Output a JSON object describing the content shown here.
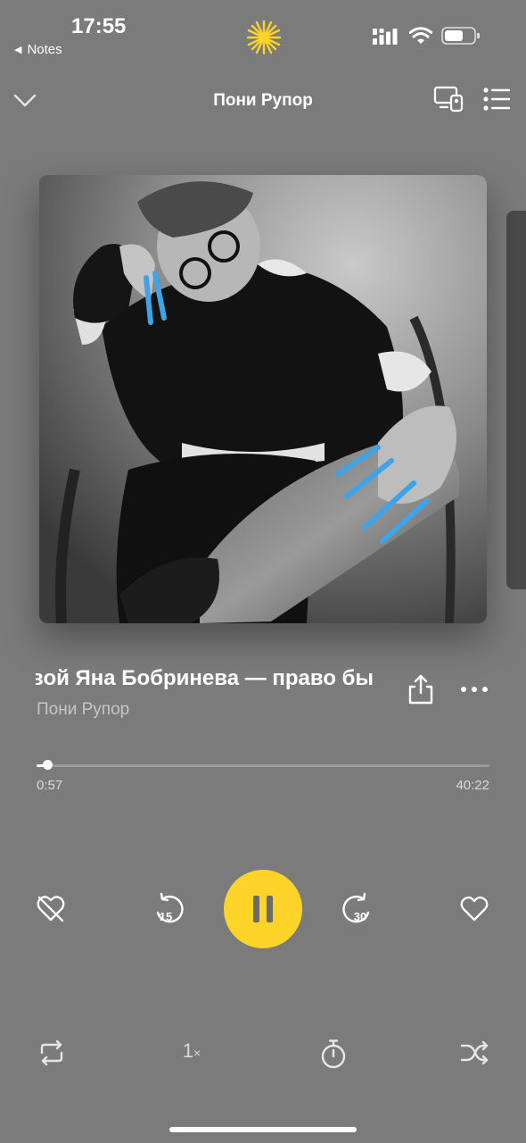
{
  "status_bar": {
    "time": "17:55",
    "back_app": "Notes"
  },
  "header": {
    "title": "Пони Рупор"
  },
  "track": {
    "title": "вой   Яна Бобринева — право бы",
    "artist": "Пони Рупор"
  },
  "progress": {
    "elapsed": "0:57",
    "total": "40:22",
    "fraction": 0.0235
  },
  "controls": {
    "rewind_seconds": "15",
    "forward_seconds": "30",
    "speed_number": "1",
    "speed_unit": "×"
  },
  "colors": {
    "background": "#7b7b7b",
    "accent": "#fed42b"
  },
  "icons": {
    "collapse": "chevron-down-icon",
    "cast": "cast-device-icon",
    "queue": "queue-list-icon",
    "share": "share-icon",
    "more": "more-dots-icon",
    "dislike": "dislike-icon",
    "rewind": "rewind-15-icon",
    "play_pause": "pause-icon",
    "forward": "forward-30-icon",
    "like": "heart-icon",
    "repeat": "repeat-icon",
    "speed": "speed-icon",
    "timer": "timer-icon",
    "shuffle": "shuffle-icon"
  }
}
